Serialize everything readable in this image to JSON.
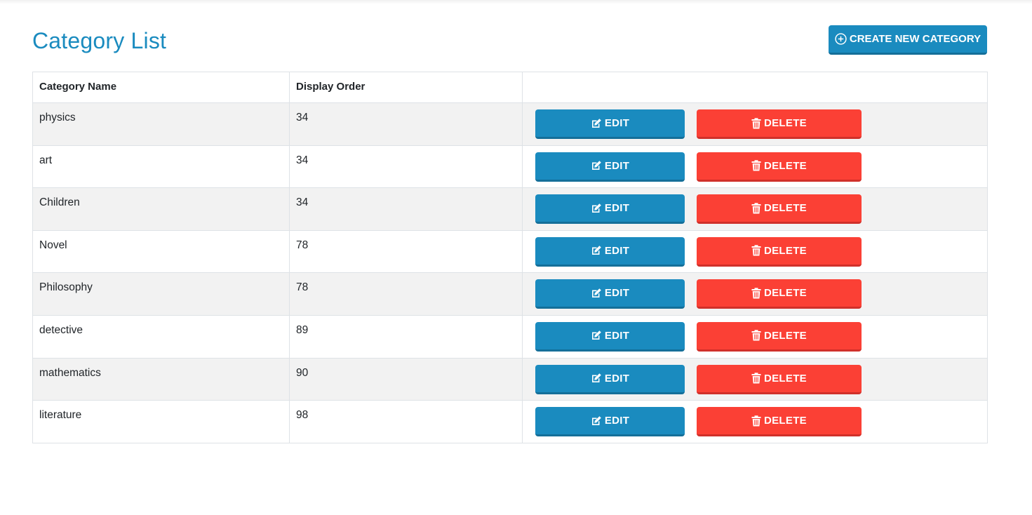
{
  "page": {
    "title": "Category List",
    "create_button_label": "CREATE NEW CATEGORY"
  },
  "table": {
    "headers": [
      "Category Name",
      "Display Order",
      ""
    ],
    "edit_label": "EDIT",
    "delete_label": "DELETE",
    "rows": [
      {
        "name": "physics",
        "order": "34"
      },
      {
        "name": "art",
        "order": "34"
      },
      {
        "name": "Children",
        "order": "34"
      },
      {
        "name": "Novel",
        "order": "78"
      },
      {
        "name": "Philosophy",
        "order": "78"
      },
      {
        "name": "detective",
        "order": "89"
      },
      {
        "name": "mathematics",
        "order": "90"
      },
      {
        "name": "literature",
        "order": "98"
      }
    ]
  },
  "icons": {
    "create": "plus-circle-icon",
    "edit": "pencil-square-icon",
    "delete": "trash-icon"
  },
  "colors": {
    "primary": "#1a8bbf",
    "danger": "#fb4035",
    "stripe": "#f2f2f2"
  }
}
